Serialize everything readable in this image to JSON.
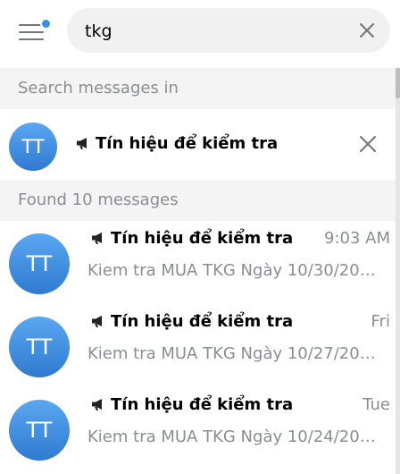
{
  "search": {
    "value": "tkg"
  },
  "sections": {
    "search_in": "Search messages in",
    "found": "Found 10 messages"
  },
  "chat_filter": {
    "avatar": "TT",
    "title": "Tín hiệu để kiểm tra"
  },
  "messages": [
    {
      "avatar": "TT",
      "title": "Tín hiệu để kiểm tra",
      "time": "9:03 AM",
      "preview": "Kiem tra MUA TKG Ngày 10/30/2023..."
    },
    {
      "avatar": "TT",
      "title": "Tín hiệu để kiểm tra",
      "time": "Fri",
      "preview": "Kiem tra MUA TKG Ngày 10/27/2023..."
    },
    {
      "avatar": "TT",
      "title": "Tín hiệu để kiểm tra",
      "time": "Tue",
      "preview": "Kiem tra MUA TKG Ngày 10/24/2023..."
    }
  ],
  "colors": {
    "accent": "#3390ec",
    "avatar": "#3f8ddd",
    "muted": "#8a8e92",
    "section_bg": "#f4f4f5"
  },
  "icons": {
    "menu": "hamburger-menu-icon",
    "clear": "close-icon",
    "channel": "megaphone-icon"
  }
}
